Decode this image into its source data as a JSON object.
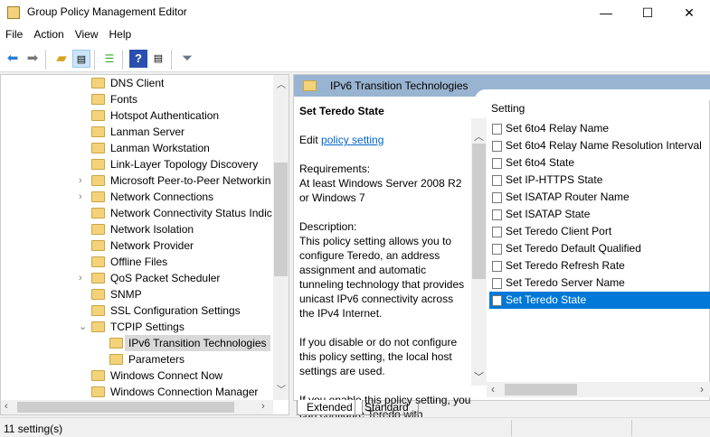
{
  "window": {
    "title": "Group Policy Management Editor",
    "minimize": "—",
    "maximize": "☐",
    "close": "✕"
  },
  "menu": [
    "File",
    "Action",
    "View",
    "Help"
  ],
  "toolbar": [
    "back-icon",
    "forward-icon",
    "up-folder-icon",
    "show-hide-tree-icon",
    "export-list-icon",
    "help-icon",
    "show-action-pane-icon",
    "filter-icon"
  ],
  "tree": [
    {
      "label": "DNS Client",
      "level": 0,
      "chevron": ""
    },
    {
      "label": "Fonts",
      "level": 0,
      "chevron": ""
    },
    {
      "label": "Hotspot Authentication",
      "level": 0,
      "chevron": ""
    },
    {
      "label": "Lanman Server",
      "level": 0,
      "chevron": ""
    },
    {
      "label": "Lanman Workstation",
      "level": 0,
      "chevron": ""
    },
    {
      "label": "Link-Layer Topology Discovery",
      "level": 0,
      "chevron": ""
    },
    {
      "label": "Microsoft Peer-to-Peer Networkin",
      "level": 0,
      "chevron": "›"
    },
    {
      "label": "Network Connections",
      "level": 0,
      "chevron": "›"
    },
    {
      "label": "Network Connectivity Status Indic",
      "level": 0,
      "chevron": ""
    },
    {
      "label": "Network Isolation",
      "level": 0,
      "chevron": ""
    },
    {
      "label": "Network Provider",
      "level": 0,
      "chevron": ""
    },
    {
      "label": "Offline Files",
      "level": 0,
      "chevron": ""
    },
    {
      "label": "QoS Packet Scheduler",
      "level": 0,
      "chevron": "›"
    },
    {
      "label": "SNMP",
      "level": 0,
      "chevron": ""
    },
    {
      "label": "SSL Configuration Settings",
      "level": 0,
      "chevron": ""
    },
    {
      "label": "TCPIP Settings",
      "level": 0,
      "chevron": "⌄"
    },
    {
      "label": "IPv6 Transition Technologies",
      "level": 1,
      "chevron": "",
      "selected": true
    },
    {
      "label": "Parameters",
      "level": 1,
      "chevron": ""
    },
    {
      "label": "Windows Connect Now",
      "level": 0,
      "chevron": ""
    },
    {
      "label": "Windows Connection Manager",
      "level": 0,
      "chevron": ""
    }
  ],
  "header": {
    "title": "IPv6 Transition Technologies"
  },
  "description": {
    "title": "Set Teredo State",
    "edit_prefix": "Edit ",
    "edit_link": "policy setting",
    "requirements": "Requirements:\nAt least Windows Server 2008 R2 or Windows 7",
    "desc": "Description:\nThis policy setting allows you to configure Teredo, an address assignment and automatic tunneling technology that provides unicast IPv6 connectivity across the IPv4 Internet.",
    "disable": "If you disable or do not configure this policy setting, the local host settings are used.",
    "enable": "If you enable this policy setting, you can configure Teredo with"
  },
  "list": {
    "column": "Setting",
    "items": [
      "Set 6to4 Relay Name",
      "Set 6to4 Relay Name Resolution Interval",
      "Set 6to4 State",
      "Set IP-HTTPS State",
      "Set ISATAP Router Name",
      "Set ISATAP State",
      "Set Teredo Client Port",
      "Set Teredo Default Qualified",
      "Set Teredo Refresh Rate",
      "Set Teredo Server Name",
      "Set Teredo State"
    ],
    "selected_index": 10
  },
  "tabs": [
    "Extended",
    "Standard"
  ],
  "status": "11 setting(s)",
  "colors": {
    "header": "#99b4d1",
    "selection": "#0078d7",
    "tree_selection": "#d9d9d9",
    "link": "#0066cc"
  }
}
